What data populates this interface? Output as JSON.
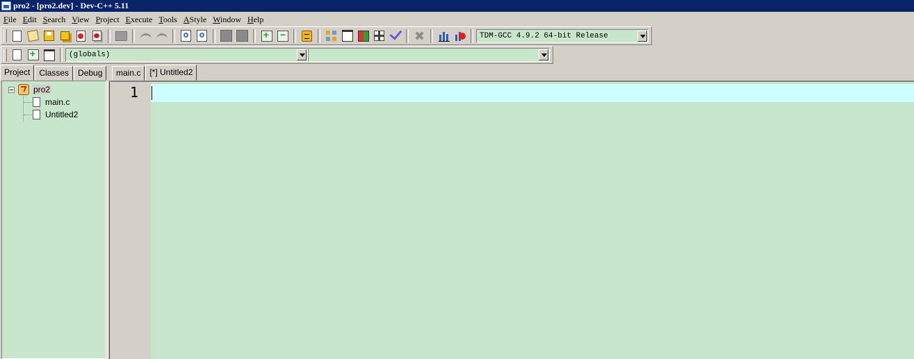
{
  "window": {
    "title": "pro2 - [pro2.dev] - Dev-C++ 5.11"
  },
  "menu": [
    "File",
    "Edit",
    "Search",
    "View",
    "Project",
    "Execute",
    "Tools",
    "AStyle",
    "Window",
    "Help"
  ],
  "toolbar": {
    "compiler_selected": "TDM-GCC 4.9.2 64-bit Release",
    "class_scope_selected": "(globals)",
    "member_selected": ""
  },
  "left_panel": {
    "tabs": [
      "Project",
      "Classes",
      "Debug"
    ],
    "active_tab": "Project",
    "tree": {
      "project": "pro2",
      "files": [
        "main.c",
        "Untitled2"
      ]
    }
  },
  "editor": {
    "tabs": [
      "main.c",
      "[*] Untitled2"
    ],
    "active_tab": "[*] Untitled2",
    "line_numbers": [
      "1"
    ],
    "active_line_color": "#ccffff",
    "background_color": "#c8e6cb"
  },
  "colors": {
    "title_bar": "#0a246a",
    "chrome": "#d4d0c8"
  },
  "icons": {
    "toolbar1": [
      "new-file-icon",
      "open-icon",
      "save-icon",
      "save-all-icon",
      "close-icon",
      "close-all-icon",
      "print-icon",
      "undo-icon",
      "redo-icon",
      "find-icon",
      "replace-icon",
      "goto-icon",
      "jump-icon",
      "add-to-project-icon",
      "remove-from-project-icon",
      "project-options-icon",
      "new-class-icon",
      "window-icon",
      "compile-icon",
      "run-icon",
      "compile-run-icon",
      "check-icon",
      "stop-icon",
      "profile-icon",
      "delete-profile-icon"
    ],
    "toolbar2": [
      "insert-icon",
      "toggle-bookmark-icon",
      "goto-bookmark-icon"
    ]
  }
}
